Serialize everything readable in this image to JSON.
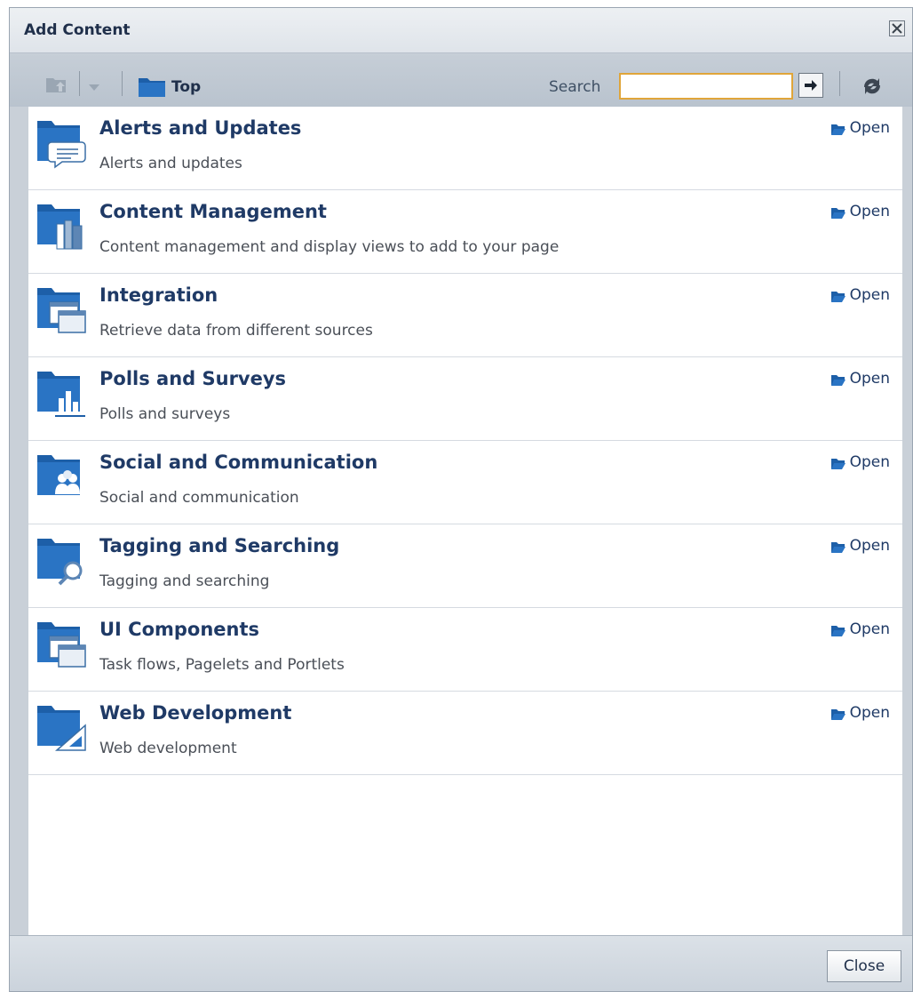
{
  "dialog": {
    "title": "Add Content"
  },
  "toolbar": {
    "breadcrumb_top": "Top",
    "search_label": "Search",
    "search_value": ""
  },
  "items": [
    {
      "name": "Alerts and Updates",
      "description": "Alerts and updates",
      "open": "Open",
      "icon": "folder-chat-icon"
    },
    {
      "name": "Content Management",
      "description": "Content management and display views to add to your page",
      "open": "Open",
      "icon": "folder-books-icon"
    },
    {
      "name": "Integration",
      "description": "Retrieve data from different sources",
      "open": "Open",
      "icon": "folder-windows-icon"
    },
    {
      "name": "Polls and Surveys",
      "description": "Polls and surveys",
      "open": "Open",
      "icon": "folder-chart-icon"
    },
    {
      "name": "Social and Communication",
      "description": "Social and communication",
      "open": "Open",
      "icon": "folder-people-icon"
    },
    {
      "name": "Tagging and Searching",
      "description": "Tagging and searching",
      "open": "Open",
      "icon": "folder-magnifier-icon"
    },
    {
      "name": "UI Components",
      "description": "Task flows, Pagelets and Portlets",
      "open": "Open",
      "icon": "folder-windows-icon"
    },
    {
      "name": "Web Development",
      "description": "Web development",
      "open": "Open",
      "icon": "folder-triangle-icon"
    }
  ],
  "footer": {
    "close_label": "Close"
  },
  "colors": {
    "link": "#1f3a66",
    "folder": "#1d5fa8",
    "search_border": "#e0a53a"
  }
}
